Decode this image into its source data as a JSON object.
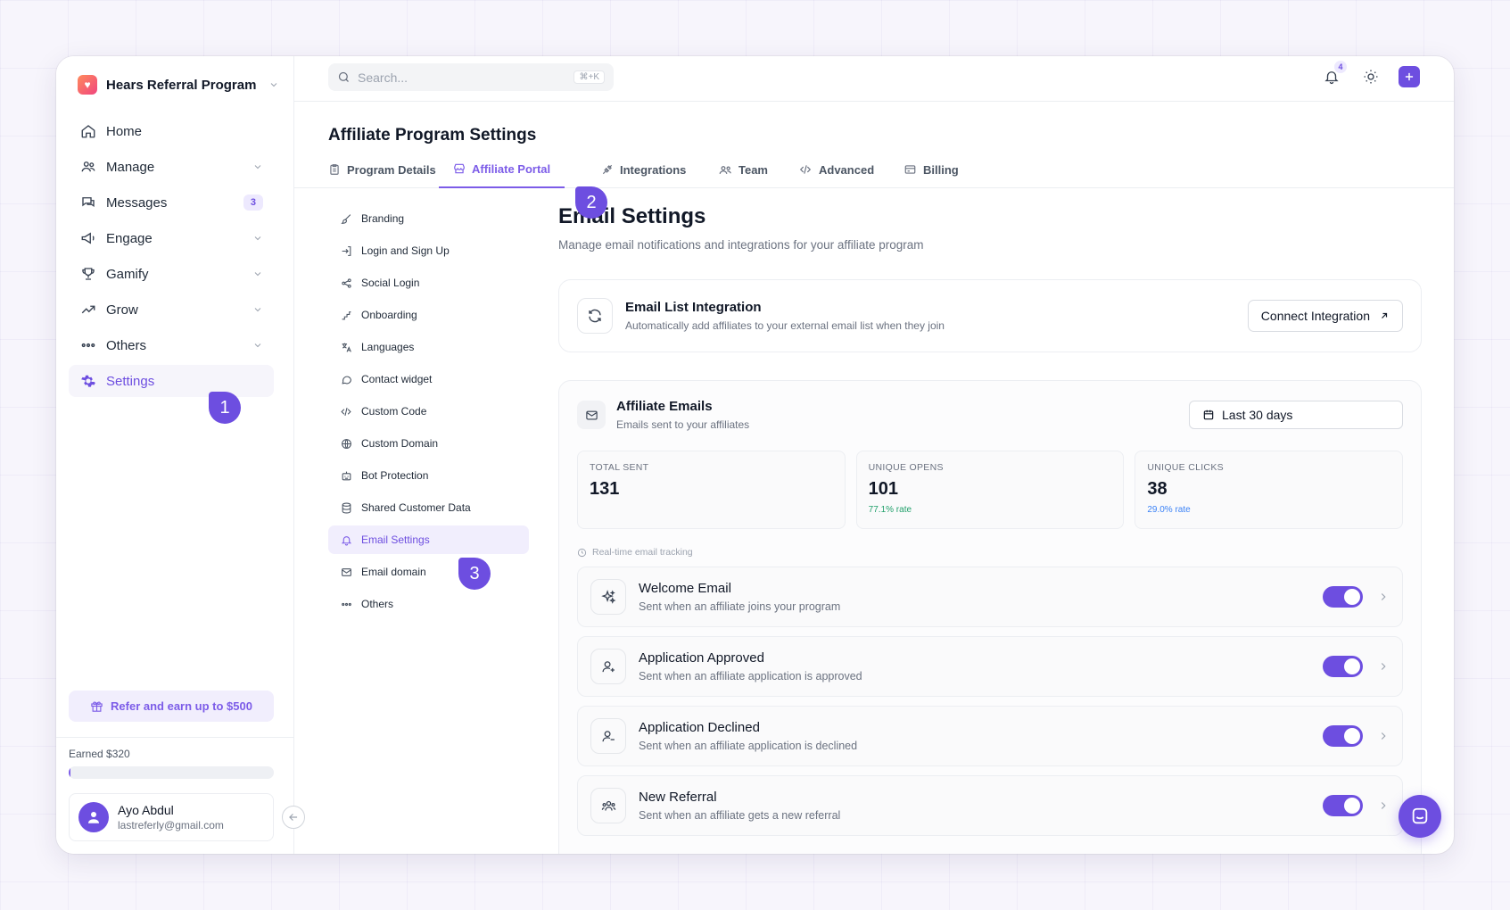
{
  "brand": {
    "name": "Hears Referral Program"
  },
  "sidebar": {
    "items": [
      {
        "label": "Home"
      },
      {
        "label": "Manage"
      },
      {
        "label": "Messages",
        "badge": "3"
      },
      {
        "label": "Engage"
      },
      {
        "label": "Gamify"
      },
      {
        "label": "Grow"
      },
      {
        "label": "Others"
      },
      {
        "label": "Settings",
        "active": true
      }
    ],
    "refer_label": "Refer and earn up to $500",
    "earned_label": "Earned $320",
    "earned_progress": 0.01,
    "user": {
      "name": "Ayo Abdul",
      "email": "lastreferly@gmail.com"
    }
  },
  "topbar": {
    "search_placeholder": "Search...",
    "shortcut": "⌘+K",
    "notification_count": "4"
  },
  "page": {
    "title": "Affiliate Program Settings"
  },
  "tabs": [
    {
      "label": "Program Details"
    },
    {
      "label": "Affiliate Portal",
      "active": true
    },
    {
      "label": "Integrations"
    },
    {
      "label": "Team"
    },
    {
      "label": "Advanced"
    },
    {
      "label": "Billing"
    }
  ],
  "subnav": [
    {
      "label": "Branding"
    },
    {
      "label": "Login and Sign Up"
    },
    {
      "label": "Social Login"
    },
    {
      "label": "Onboarding"
    },
    {
      "label": "Languages"
    },
    {
      "label": "Contact widget"
    },
    {
      "label": "Custom Code"
    },
    {
      "label": "Custom Domain"
    },
    {
      "label": "Bot Protection"
    },
    {
      "label": "Shared Customer Data"
    },
    {
      "label": "Email Settings",
      "active": true
    },
    {
      "label": "Email domain"
    },
    {
      "label": "Others"
    }
  ],
  "email_settings": {
    "title": "Email Settings",
    "subtitle": "Manage email notifications and integrations for your affiliate program",
    "integration": {
      "title": "Email List Integration",
      "desc": "Automatically add affiliates to your external email list when they join",
      "button": "Connect Integration"
    },
    "affiliate_emails": {
      "title": "Affiliate Emails",
      "desc": "Emails sent to your affiliates",
      "range": "Last 30 days",
      "stats": [
        {
          "label": "TOTAL SENT",
          "value": "131",
          "rate": ""
        },
        {
          "label": "UNIQUE OPENS",
          "value": "101",
          "rate": "77.1% rate",
          "rate_color": "#22a06b"
        },
        {
          "label": "UNIQUE CLICKS",
          "value": "38",
          "rate": "29.0% rate",
          "rate_color": "#3b82f6"
        }
      ],
      "tracking_label": "Real-time email tracking",
      "rows": [
        {
          "title": "Welcome Email",
          "desc": "Sent when an affiliate joins your program",
          "enabled": true
        },
        {
          "title": "Application Approved",
          "desc": "Sent when an affiliate application is approved",
          "enabled": true
        },
        {
          "title": "Application Declined",
          "desc": "Sent when an affiliate application is declined",
          "enabled": true
        },
        {
          "title": "New Referral",
          "desc": "Sent when an affiliate gets a new referral",
          "enabled": true
        }
      ]
    }
  },
  "steps": [
    "1",
    "2",
    "3"
  ],
  "colors": {
    "accent": "#6d4ee0",
    "accent_light": "#f1eefd"
  }
}
